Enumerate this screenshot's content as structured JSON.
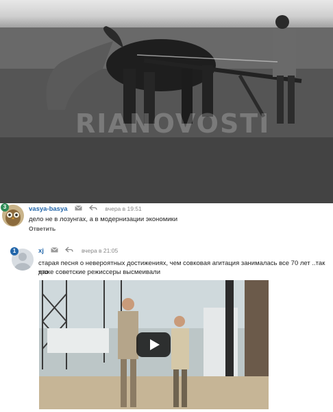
{
  "photo": {
    "watermark": "RIANOVOSTI"
  },
  "comments": [
    {
      "username": "vasya-basya",
      "rank": "3",
      "time": "вчера в 19:51",
      "text": "дело не в лозунгах, а в модернизации экономики",
      "reply_label": "Ответить",
      "rank_color": "#2e8b57"
    },
    {
      "username": "xj",
      "rank": "1",
      "time": "вчера в 21:05",
      "text_line1": "старая песня о невероятных достижениях, чем совковая агитация занималась все 70 лет ..так что",
      "text_line2": "даже советские режиссеры высмеивали",
      "rank_color": "#2266aa"
    }
  ],
  "icons": {
    "message": "envelope-icon",
    "reply": "reply-arrow-icon",
    "play": "play-icon"
  },
  "colors": {
    "username": "#2266aa"
  }
}
